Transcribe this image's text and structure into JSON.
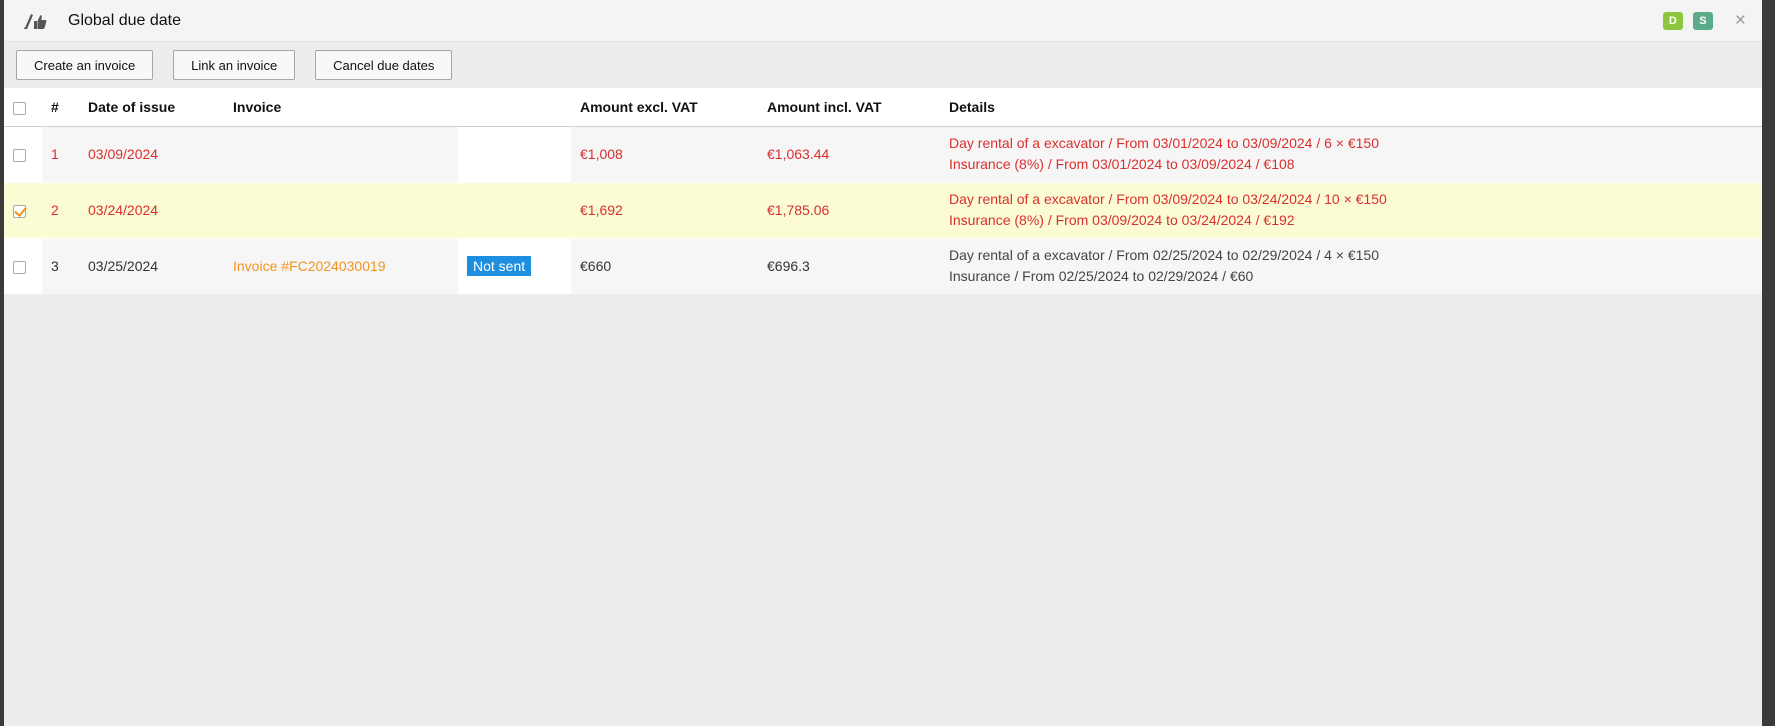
{
  "window": {
    "title": "Global due date",
    "badges": [
      {
        "label": "D",
        "color": "#8cc63f"
      },
      {
        "label": "S",
        "color": "#5aab8a"
      }
    ],
    "close_icon": "×"
  },
  "toolbar": {
    "create_label": "Create an invoice",
    "link_label": "Link an invoice",
    "cancel_label": "Cancel due dates"
  },
  "table": {
    "headers": {
      "num": "#",
      "date": "Date of issue",
      "invoice": "Invoice",
      "status": "",
      "excl": "Amount excl. VAT",
      "incl": "Amount incl. VAT",
      "details": "Details"
    },
    "rows": [
      {
        "num": "1",
        "date": "03/09/2024",
        "invoice": "",
        "status": "",
        "excl": "€1,008",
        "incl": "€1,063.44",
        "detail1": "Day rental of a excavator / From 03/01/2024 to 03/09/2024 / 6 × €150",
        "detail2": "Insurance (8%) / From 03/01/2024 to 03/09/2024 / €108",
        "checked": false
      },
      {
        "num": "2",
        "date": "03/24/2024",
        "invoice": "",
        "status": "",
        "excl": "€1,692",
        "incl": "€1,785.06",
        "detail1": "Day rental of a excavator / From 03/09/2024 to 03/24/2024 / 10 × €150",
        "detail2": "Insurance (8%) / From 03/09/2024 to 03/24/2024 / €192",
        "checked": true
      },
      {
        "num": "3",
        "date": "03/25/2024",
        "invoice": "Invoice #FC2024030019",
        "status": "Not sent",
        "excl": "€660",
        "incl": "€696.3",
        "detail1": "Day rental of a excavator / From 02/25/2024 to 02/29/2024 / 4 × €150",
        "detail2": "Insurance / From 02/25/2024 to 02/29/2024 / €60",
        "checked": false
      }
    ]
  },
  "colors": {
    "overdue_text": "#d9302e",
    "link": "#f29320",
    "status_badge": "#1e8fe0",
    "selected_row": "#fbfbd4"
  }
}
